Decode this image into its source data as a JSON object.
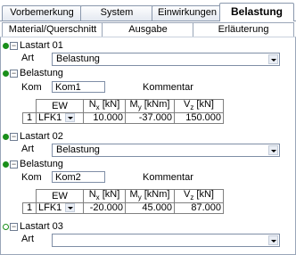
{
  "tabs_row1": [
    "Vorbemerkung",
    "System",
    "Einwirkungen",
    "Belastung"
  ],
  "tabs_row2": [
    "Material/Querschnitt",
    "Ausgabe",
    "Erläuterung"
  ],
  "sections": {
    "lastart01": {
      "title": "Lastart 01",
      "art_label": "Art",
      "art_value": "Belastung"
    },
    "belastung1": {
      "title": "Belastung",
      "kom_label": "Kom",
      "kom_value": "Kom1",
      "kommentar_label": "Kommentar",
      "headers": [
        "EW",
        "N",
        "M",
        "V"
      ],
      "header_units": [
        "[kN]",
        "[kNm]",
        "[kN]"
      ],
      "header_subs": [
        "x",
        "y",
        "z"
      ],
      "row": {
        "no": "1",
        "ew": "LFK1",
        "nx": "10.000",
        "my": "-37.000",
        "vz": "150.000"
      }
    },
    "lastart02": {
      "title": "Lastart 02",
      "art_label": "Art",
      "art_value": "Belastung"
    },
    "belastung2": {
      "title": "Belastung",
      "kom_label": "Kom",
      "kom_value": "Kom2",
      "kommentar_label": "Kommentar",
      "headers": [
        "EW",
        "N",
        "M",
        "V"
      ],
      "header_units": [
        "[kN]",
        "[kNm]",
        "[kN]"
      ],
      "header_subs": [
        "x",
        "y",
        "z"
      ],
      "row": {
        "no": "1",
        "ew": "LFK1",
        "nx": "-20.000",
        "my": "45.000",
        "vz": "87.000"
      }
    },
    "lastart03": {
      "title": "Lastart 03",
      "art_label": "Art",
      "art_value": ""
    }
  },
  "toggle_symbol": "−",
  "colors": {
    "dot_green": "#1a8f1a",
    "tab_border": "#8a98ad"
  }
}
